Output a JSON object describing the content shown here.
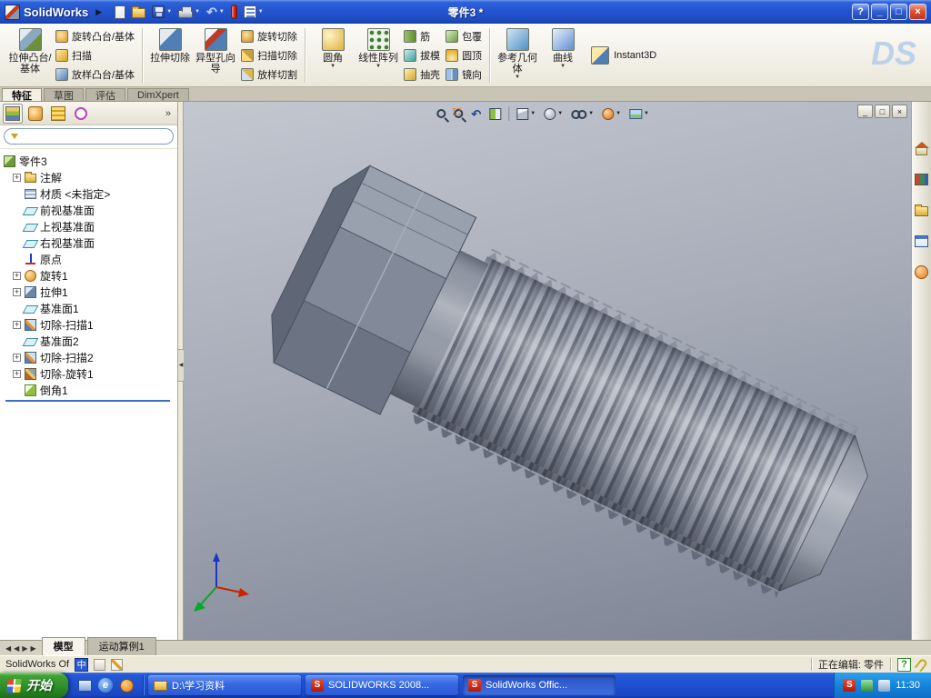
{
  "glyphs": {
    "menu_arrow": "▶",
    "dropdown": "▼",
    "chevrons": "»",
    "expand": "+",
    "undo": "↶",
    "help": "?",
    "minimize": "_",
    "restore": "□",
    "close": "×",
    "nav_prev": "◀",
    "nav_next": "▶",
    "grip": "◀",
    "ie": "e",
    "s": "S"
  },
  "titlebar": {
    "app_name": "SolidWorks",
    "doc_title": "零件3 *"
  },
  "command_manager": {
    "extrude_boss": "拉伸凸台/基体",
    "revolve_boss": "旋转凸台/基体",
    "sweep_boss": "扫描",
    "loft_boss": "放样凸台/基体",
    "extrude_cut": "拉伸切除",
    "hole_wizard": "异型孔向导",
    "revolve_cut": "旋转切除",
    "sweep_cut": "扫描切除",
    "loft_cut": "放样切割",
    "fillet": "圆角",
    "linear_pattern": "线性阵列",
    "rib": "筋",
    "draft": "拔模",
    "shell": "抽壳",
    "wrap": "包覆",
    "dome": "圆顶",
    "mirror": "镜向",
    "reference_geometry": "参考几何体",
    "curves": "曲线",
    "instant3d": "Instant3D"
  },
  "watermark": "DS",
  "manager_tabs": {
    "features": "特征",
    "sketch": "草图",
    "evaluate": "评估",
    "dimxpert": "DimXpert"
  },
  "feature_tree": {
    "root": "零件3",
    "items": [
      {
        "label": "注解"
      },
      {
        "label": "材质 <未指定>"
      },
      {
        "label": "前视基准面"
      },
      {
        "label": "上视基准面"
      },
      {
        "label": "右视基准面"
      },
      {
        "label": "原点"
      },
      {
        "label": "旋转1"
      },
      {
        "label": "拉伸1"
      },
      {
        "label": "基准面1"
      },
      {
        "label": "切除-扫描1"
      },
      {
        "label": "基准面2"
      },
      {
        "label": "切除-扫描2"
      },
      {
        "label": "切除-旋转1"
      },
      {
        "label": "倒角1"
      }
    ]
  },
  "doc_tabs": {
    "model": "模型",
    "motion_study": "运动算例1"
  },
  "status_bar": {
    "left": "SolidWorks Of",
    "ime": "中",
    "editing": "正在编辑: 零件",
    "help_badge": "?"
  },
  "taskbar": {
    "start": "开始",
    "tasks": [
      {
        "label": "D:\\学习资料"
      },
      {
        "label": "SOLIDWORKS 2008..."
      },
      {
        "label": "SolidWorks Offic..."
      }
    ],
    "tray_time": "11:30"
  }
}
